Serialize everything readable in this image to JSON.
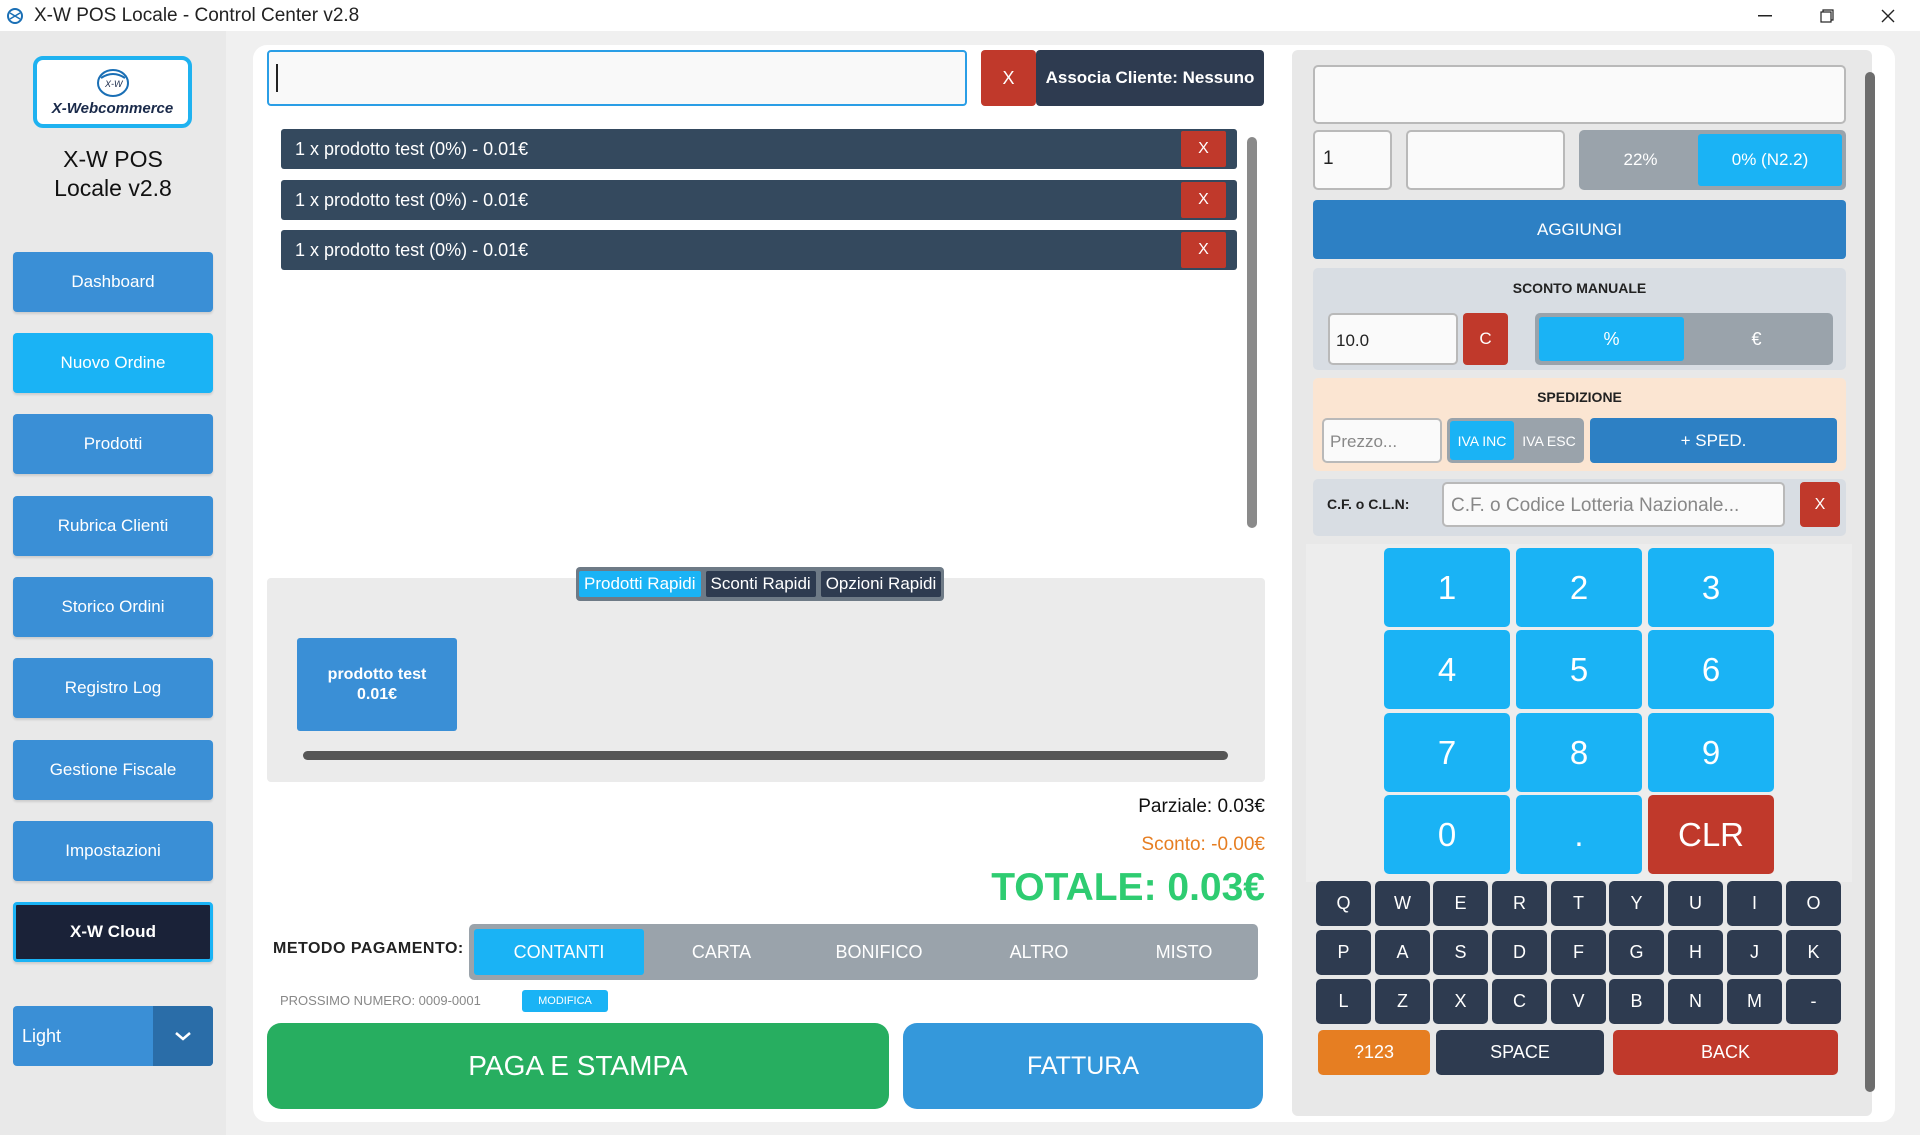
{
  "window": {
    "title": "X-W POS Locale - Control Center v2.8"
  },
  "sidebar": {
    "logo_top": "X-W",
    "logo_sub": "X-Webcommerce",
    "app_name_line1": "X-W POS",
    "app_name_line2": "Locale v2.8",
    "items": [
      {
        "label": "Dashboard"
      },
      {
        "label": "Nuovo Ordine"
      },
      {
        "label": "Prodotti"
      },
      {
        "label": "Rubrica Clienti"
      },
      {
        "label": "Storico Ordini"
      },
      {
        "label": "Registro Log"
      },
      {
        "label": "Gestione Fiscale"
      },
      {
        "label": "Impostazioni"
      },
      {
        "label": "X-W Cloud"
      }
    ],
    "theme": "Light"
  },
  "order": {
    "search_value": "",
    "clear_label": "X",
    "client_label": "Associa Cliente: Nessuno",
    "cart": [
      {
        "text": "1 x prodotto test (0%) - 0.01€",
        "remove": "X"
      },
      {
        "text": "1 x prodotto test (0%) - 0.01€",
        "remove": "X"
      },
      {
        "text": "1 x prodotto test (0%) - 0.01€",
        "remove": "X"
      }
    ],
    "quick_tabs": [
      {
        "label": "Prodotti Rapidi"
      },
      {
        "label": "Sconti Rapidi"
      },
      {
        "label": "Opzioni Rapidi"
      }
    ],
    "quick_products": [
      {
        "name": "prodotto test",
        "price": "0.01€"
      }
    ],
    "parziale": "Parziale: 0.03€",
    "sconto": "Sconto: -0.00€",
    "totale": "TOTALE: 0.03€",
    "payment_label": "METODO PAGAMENTO:",
    "payment_methods": [
      {
        "label": "CONTANTI"
      },
      {
        "label": "CARTA"
      },
      {
        "label": "BONIFICO"
      },
      {
        "label": "ALTRO"
      },
      {
        "label": "MISTO"
      }
    ],
    "payment_selected": "CONTANTI",
    "next_number": "PROSSIMO NUMERO: 0009-0001",
    "modifica_label": "MODIFICA",
    "pay_button": "PAGA E STAMPA",
    "invoice_button": "FATTURA"
  },
  "entry": {
    "display_value": "",
    "qty_value": "1",
    "price_value": "",
    "vat_options": [
      {
        "label": "22%"
      },
      {
        "label": "0% (N2.2)"
      }
    ],
    "vat_selected": "0% (N2.2)",
    "add_button": "AGGIUNGI",
    "discount": {
      "title": "SCONTO MANUALE",
      "value": "10.0",
      "clear_label": "C",
      "options": [
        {
          "label": "%"
        },
        {
          "label": "€"
        }
      ],
      "selected": "%"
    },
    "shipping": {
      "title": "SPEDIZIONE",
      "placeholder": "Prezzo...",
      "iva_options": [
        {
          "label": "IVA INC"
        },
        {
          "label": "IVA ESC"
        }
      ],
      "iva_selected": "IVA INC",
      "add_label": "+ SPED."
    },
    "cf": {
      "label": "C.F. o C.L.N:",
      "placeholder": "C.F. o Codice Lotteria Nazionale...",
      "clear_label": "X"
    }
  },
  "numpad": {
    "keys": [
      "1",
      "2",
      "3",
      "4",
      "5",
      "6",
      "7",
      "8",
      "9",
      "0",
      ".",
      "CLR"
    ]
  },
  "keyboard": {
    "row1": [
      "Q",
      "W",
      "E",
      "R",
      "T",
      "Y",
      "U",
      "I",
      "O"
    ],
    "row2": [
      "P",
      "A",
      "S",
      "D",
      "F",
      "G",
      "H",
      "J",
      "K"
    ],
    "row3": [
      "L",
      "Z",
      "X",
      "C",
      "V",
      "B",
      "N",
      "M",
      "-"
    ],
    "num_label": "?123",
    "space_label": "SPACE",
    "back_label": "BACK"
  },
  "colors": {
    "accent": "#1ab3f5",
    "primary": "#3a8fd6",
    "danger": "#c0392b",
    "dark": "#2e3b50",
    "success": "#27ae60",
    "total_green": "#2ecc71",
    "discount_orange": "#e67e22"
  }
}
